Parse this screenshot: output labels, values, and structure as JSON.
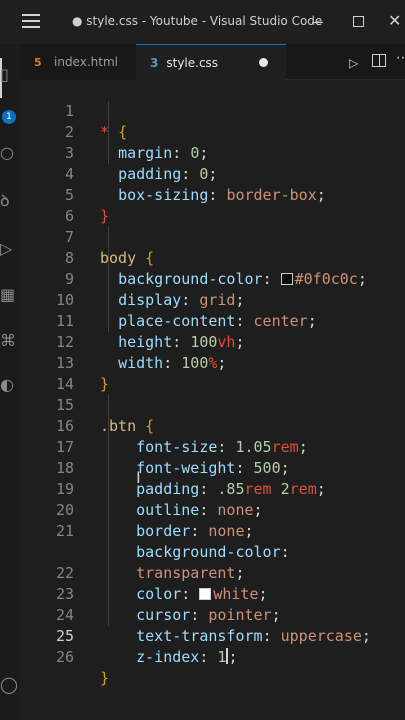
{
  "window": {
    "title": "● style.css - Youtube - Visual Studio Code",
    "min_glyph": "—",
    "close_glyph": "✕"
  },
  "activity_bar": {
    "icons": [
      "explorer-icon",
      "search-icon",
      "source-control-icon",
      "run-debug-icon",
      "extensions-icon",
      "remote-icon",
      "live-share-icon",
      "account-icon",
      "settings-icon"
    ],
    "badge": "1"
  },
  "tabs": [
    {
      "label": "index.html",
      "icon": "html-file-icon",
      "icon_glyph": "5",
      "active": false
    },
    {
      "label": "style.css",
      "icon": "css-file-icon",
      "icon_glyph": "3",
      "active": true,
      "modified": true
    }
  ],
  "editor_actions": {
    "run_glyph": "▷",
    "more_glyph": "⋯"
  },
  "editor": {
    "current_line": 25,
    "line_numbers": [
      "1",
      "2",
      "3",
      "4",
      "5",
      "6",
      "7",
      "8",
      "9",
      "10",
      "11",
      "12",
      "13",
      "14",
      "15",
      "16",
      "17",
      "18",
      "19",
      "20",
      "21",
      "",
      "22",
      "23",
      "24",
      "25",
      "26"
    ],
    "lines": [
      {
        "selector": "*",
        "open": "{"
      },
      {
        "prop": "margin",
        "value": "0",
        "end": ";"
      },
      {
        "prop": "padding",
        "value": "0",
        "end": ";"
      },
      {
        "prop": "box-sizing",
        "value": "border-box",
        "end": ";"
      },
      {
        "close": "}"
      },
      {},
      {
        "selector": "body",
        "open": "{"
      },
      {
        "prop": "background-color",
        "swatch": "#0f0c0c",
        "value": "#0f0c0c",
        "end": ";"
      },
      {
        "prop": "display",
        "value": "grid",
        "end": ";"
      },
      {
        "prop": "place-content",
        "value": "center",
        "end": ";"
      },
      {
        "prop": "height",
        "num": "100",
        "unit": "vh",
        "end": ";"
      },
      {
        "prop": "width",
        "num": "100",
        "unit": "%",
        "end": ";"
      },
      {
        "close": "}"
      },
      {},
      {
        "selector": ".btn",
        "open": "{"
      },
      {
        "prop": "font-size",
        "num": "1.05",
        "unit": "rem",
        "end": ";"
      },
      {
        "prop": "font-weight",
        "num": "500",
        "end": ";"
      },
      {
        "prop": "padding",
        "num": ".85",
        "unit": "rem",
        "num2": "2",
        "unit2": "rem",
        "end": ";"
      },
      {
        "prop": "outline",
        "value": "none",
        "end": ";"
      },
      {
        "prop": "border",
        "value": "none",
        "end": ";"
      },
      {
        "prop": "background-color",
        "value": "",
        "end": ""
      },
      {
        "value": "transparent",
        "end": ";"
      },
      {
        "prop": "color",
        "swatch": "#ffffff",
        "value": "white",
        "end": ";"
      },
      {
        "prop": "cursor",
        "value": "pointer",
        "end": ";"
      },
      {
        "prop": "text-transform",
        "value": "uppercase",
        "end": ";"
      },
      {
        "prop": "z-index",
        "num": "1",
        "end": ";"
      },
      {
        "close": "}"
      }
    ]
  },
  "colors": {
    "selector": "#d7ba7d",
    "property": "#9cdcfe",
    "value": "#ce9178",
    "number": "#b5cea8",
    "brace": "#d4a017",
    "accent": "#0e70c0"
  }
}
